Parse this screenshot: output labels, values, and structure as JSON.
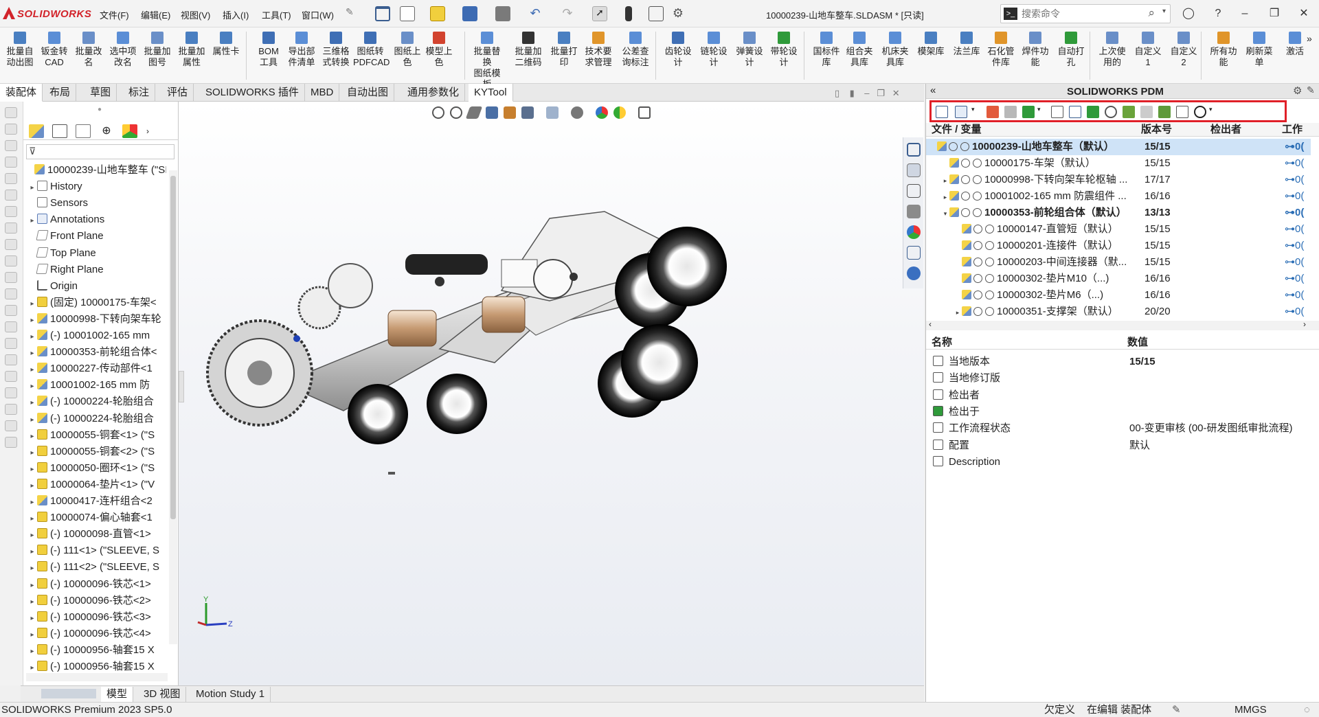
{
  "app": {
    "brand": "SOLIDWORKS",
    "document_title": "10000239-山地车整车.SLDASM * [只读]"
  },
  "menu": [
    "文件(F)",
    "编辑(E)",
    "视图(V)",
    "插入(I)",
    "工具(T)",
    "窗口(W)"
  ],
  "search": {
    "placeholder": "搜索命令"
  },
  "ribbon": {
    "buttons": [
      {
        "l1": "批量自",
        "l2": "动出图",
        "color": "#4a7fc1"
      },
      {
        "l1": "钣金转",
        "l2": "CAD",
        "color": "#5b8ed6"
      },
      {
        "l1": "批量改",
        "l2": "名",
        "color": "#6a8fc8"
      },
      {
        "l1": "选中项",
        "l2": "改名",
        "color": "#5b8ed6"
      },
      {
        "l1": "批量加",
        "l2": "图号",
        "color": "#6a8fc8"
      },
      {
        "l1": "批量加",
        "l2": "属性",
        "color": "#4a7fc1"
      },
      {
        "l1": "属性卡",
        "l2": "",
        "color": "#4a7fc1"
      },
      {
        "l1": "BOM",
        "l2": "工具",
        "color": "#3f6fb5"
      },
      {
        "l1": "导出部",
        "l2": "件清单",
        "color": "#5b8ed6"
      },
      {
        "l1": "三维格",
        "l2": "式转换",
        "color": "#3f6fb5"
      },
      {
        "l1": "图纸转",
        "l2": "PDFCAD",
        "color": "#3f6fb5"
      },
      {
        "l1": "图纸上",
        "l2": "色",
        "color": "#6a8fc8"
      },
      {
        "l1": "模型上",
        "l2": "色",
        "color": "#d2432f"
      },
      {
        "l1": "批量替换",
        "l2": "图纸模板",
        "color": "#5b8ed6"
      },
      {
        "l1": "批量加",
        "l2": "二维码",
        "color": "#333333"
      },
      {
        "l1": "批量打",
        "l2": "印",
        "color": "#4a7fc1"
      },
      {
        "l1": "技术要",
        "l2": "求管理",
        "color": "#e0952a"
      },
      {
        "l1": "公差查",
        "l2": "询标注",
        "color": "#5b8ed6"
      },
      {
        "l1": "齿轮设",
        "l2": "计",
        "color": "#3f6fb5"
      },
      {
        "l1": "链轮设",
        "l2": "计",
        "color": "#5b8ed6"
      },
      {
        "l1": "弹簧设",
        "l2": "计",
        "color": "#6a8fc8"
      },
      {
        "l1": "带轮设",
        "l2": "计",
        "color": "#2f9a3a"
      },
      {
        "l1": "国标件",
        "l2": "库",
        "color": "#5b8ed6"
      },
      {
        "l1": "组合夹",
        "l2": "具库",
        "color": "#5b8ed6"
      },
      {
        "l1": "机床夹",
        "l2": "具库",
        "color": "#5b8ed6"
      },
      {
        "l1": "模架库",
        "l2": "",
        "color": "#4a7fc1"
      },
      {
        "l1": "法兰库",
        "l2": "",
        "color": "#4a7fc1"
      },
      {
        "l1": "石化管",
        "l2": "件库",
        "color": "#e0952a"
      },
      {
        "l1": "焊件功",
        "l2": "能",
        "color": "#6a8fc8"
      },
      {
        "l1": "自动打",
        "l2": "孔",
        "color": "#2f9a3a"
      },
      {
        "l1": "上次使",
        "l2": "用的",
        "color": "#6a8fc8"
      },
      {
        "l1": "自定义",
        "l2": "1",
        "color": "#6a8fc8"
      },
      {
        "l1": "自定义",
        "l2": "2",
        "color": "#6a8fc8"
      },
      {
        "l1": "所有功",
        "l2": "能",
        "color": "#e0952a"
      },
      {
        "l1": "刷新菜",
        "l2": "单",
        "color": "#5b8ed6"
      },
      {
        "l1": "激活",
        "l2": "",
        "color": "#5b8ed6"
      }
    ]
  },
  "tabs": [
    "装配体",
    "布局",
    "草图",
    "标注",
    "评估",
    "SOLIDWORKS 插件",
    "MBD",
    "自动出图",
    "通用参数化",
    "KYTool"
  ],
  "tree": {
    "rows": [
      {
        "label": "10000239-山地车整车 (\"SI",
        "icon": "asm",
        "arrow": "",
        "indent": 0
      },
      {
        "label": "History",
        "icon": "hist",
        "arrow": "▸",
        "indent": 1
      },
      {
        "label": "Sensors",
        "icon": "sens",
        "arrow": "",
        "indent": 1
      },
      {
        "label": "Annotations",
        "icon": "ann",
        "arrow": "▸",
        "indent": 1
      },
      {
        "label": "Front Plane",
        "icon": "plane",
        "arrow": "",
        "indent": 1
      },
      {
        "label": "Top Plane",
        "icon": "plane",
        "arrow": "",
        "indent": 1
      },
      {
        "label": "Right Plane",
        "icon": "plane",
        "arrow": "",
        "indent": 1
      },
      {
        "label": "Origin",
        "icon": "orig",
        "arrow": "",
        "indent": 1
      },
      {
        "label": "(固定) 10000175-车架<",
        "icon": "part",
        "arrow": "▸",
        "indent": 1
      },
      {
        "label": "10000998-下转向架车轮",
        "icon": "asm",
        "arrow": "▸",
        "indent": 1
      },
      {
        "label": "(-) 10001002-165 mm",
        "icon": "asm",
        "arrow": "▸",
        "indent": 1
      },
      {
        "label": "10000353-前轮组合体<",
        "icon": "asm",
        "arrow": "▸",
        "indent": 1
      },
      {
        "label": "10000227-传动部件<1",
        "icon": "asm",
        "arrow": "▸",
        "indent": 1
      },
      {
        "label": "10001002-165 mm 防",
        "icon": "asm",
        "arrow": "▸",
        "indent": 1
      },
      {
        "label": "(-) 10000224-轮胎组合",
        "icon": "asm",
        "arrow": "▸",
        "indent": 1
      },
      {
        "label": "(-) 10000224-轮胎组合",
        "icon": "asm",
        "arrow": "▸",
        "indent": 1
      },
      {
        "label": "10000055-铜套<1> (\"S",
        "icon": "part",
        "arrow": "▸",
        "indent": 1
      },
      {
        "label": "10000055-铜套<2> (\"S",
        "icon": "part",
        "arrow": "▸",
        "indent": 1
      },
      {
        "label": "10000050-圈环<1> (\"S",
        "icon": "part",
        "arrow": "▸",
        "indent": 1
      },
      {
        "label": "10000064-垫片<1> (\"V",
        "icon": "part",
        "arrow": "▸",
        "indent": 1
      },
      {
        "label": "10000417-连杆组合<2",
        "icon": "asm",
        "arrow": "▸",
        "indent": 1
      },
      {
        "label": "10000074-偏心轴套<1",
        "icon": "part",
        "arrow": "▸",
        "indent": 1
      },
      {
        "label": "(-) 10000098-直管<1>",
        "icon": "part",
        "arrow": "▸",
        "indent": 1
      },
      {
        "label": "(-) 111<1> (\"SLEEVE, S",
        "icon": "part",
        "arrow": "▸",
        "indent": 1
      },
      {
        "label": "(-) 111<2> (\"SLEEVE, S",
        "icon": "part",
        "arrow": "▸",
        "indent": 1
      },
      {
        "label": "(-) 10000096-铁芯<1>",
        "icon": "part",
        "arrow": "▸",
        "indent": 1
      },
      {
        "label": "(-) 10000096-铁芯<2>",
        "icon": "part",
        "arrow": "▸",
        "indent": 1
      },
      {
        "label": "(-) 10000096-铁芯<3>",
        "icon": "part",
        "arrow": "▸",
        "indent": 1
      },
      {
        "label": "(-) 10000096-铁芯<4>",
        "icon": "part",
        "arrow": "▸",
        "indent": 1
      },
      {
        "label": "(-) 10000956-轴套15 X",
        "icon": "part",
        "arrow": "▸",
        "indent": 1
      },
      {
        "label": "(-) 10000956-轴套15 X",
        "icon": "part",
        "arrow": "▸",
        "indent": 1
      }
    ]
  },
  "bottom_tabs": [
    "模型",
    "3D 视图",
    "Motion Study 1"
  ],
  "status": {
    "product": "SOLIDWORKS Premium 2023 SP5.0",
    "state1": "欠定义",
    "state2": "在编辑 装配体",
    "units": "MMGS"
  },
  "pdm": {
    "title": "SOLIDWORKS PDM",
    "columns": {
      "file": "文件 / 变量",
      "version": "版本号",
      "checked_out_by": "检出者",
      "work": "工作"
    },
    "rows": [
      {
        "name": "10000239-山地车整车（默认）",
        "version": "15/15",
        "indent": 0,
        "arrow": "",
        "bold": true,
        "selected": true
      },
      {
        "name": "10000175-车架（默认）",
        "version": "15/15",
        "indent": 1,
        "arrow": "",
        "bold": false
      },
      {
        "name": "10000998-下转向架车轮枢轴 ...",
        "version": "17/17",
        "indent": 1,
        "arrow": "▸",
        "bold": false
      },
      {
        "name": "10001002-165 mm 防震组件 ...",
        "version": "16/16",
        "indent": 1,
        "arrow": "▸",
        "bold": false
      },
      {
        "name": "10000353-前轮组合体（默认）",
        "version": "13/13",
        "indent": 1,
        "arrow": "▾",
        "bold": true
      },
      {
        "name": "10000147-直管短（默认）",
        "version": "15/15",
        "indent": 2,
        "arrow": "",
        "bold": false
      },
      {
        "name": "10000201-连接件（默认）",
        "version": "15/15",
        "indent": 2,
        "arrow": "",
        "bold": false
      },
      {
        "name": "10000203-中间连接器（默...",
        "version": "15/15",
        "indent": 2,
        "arrow": "",
        "bold": false
      },
      {
        "name": "10000302-垫片M10（...)",
        "version": "16/16",
        "indent": 2,
        "arrow": "",
        "bold": false
      },
      {
        "name": "10000302-垫片M6（...)",
        "version": "16/16",
        "indent": 2,
        "arrow": "",
        "bold": false
      },
      {
        "name": "10000351-支撑架（默认）",
        "version": "20/20",
        "indent": 2,
        "arrow": "▸",
        "bold": false
      }
    ],
    "work_cut": "0(",
    "props_header": {
      "name": "名称",
      "value": "数值"
    },
    "props": [
      {
        "name": "当地版本",
        "value": "15/15",
        "bold": true
      },
      {
        "name": "当地修订版",
        "value": ""
      },
      {
        "name": "检出者",
        "value": ""
      },
      {
        "name": "检出于",
        "value": ""
      },
      {
        "name": "工作流程状态",
        "value": "00-变更审核 (00-研发图纸审批流程)"
      },
      {
        "name": "配置",
        "value": "默认"
      },
      {
        "name": "Description",
        "value": ""
      }
    ]
  },
  "colors": {
    "brand_red": "#d2232a",
    "highlight_box": "#e02028",
    "selection": "#cfe3f7"
  }
}
